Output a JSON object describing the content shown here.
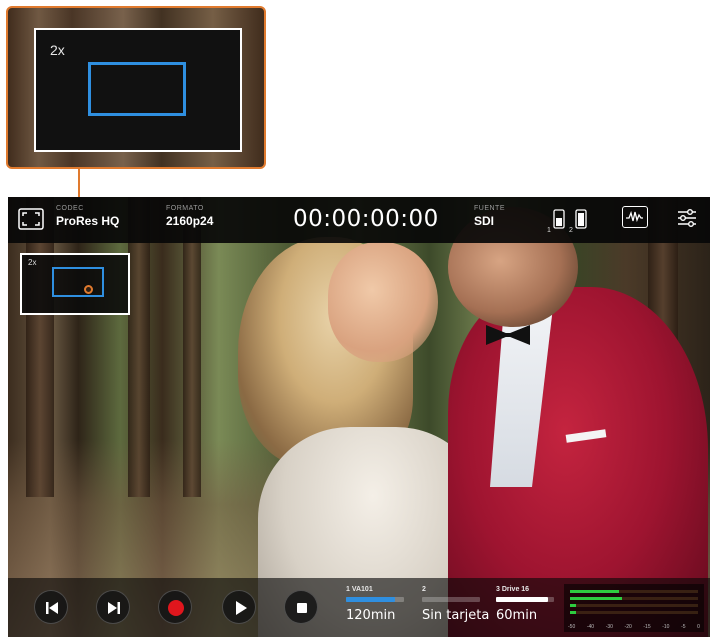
{
  "callout": {
    "zoom_label": "2x"
  },
  "topbar": {
    "codec": {
      "label": "CODEC",
      "value": "ProRes HQ"
    },
    "format": {
      "label": "FORMATO",
      "value": "2160p24"
    },
    "timecode": "00:00:00:00",
    "source": {
      "label": "FUENTE",
      "value": "SDI"
    },
    "slots": [
      {
        "number": "1"
      },
      {
        "number": "2"
      }
    ],
    "icons": {
      "fullscreen": "fullscreen-icon",
      "slots": "sd-card-icon",
      "scope": "waveform-icon",
      "settings": "sliders-icon"
    }
  },
  "inset": {
    "zoom_label": "2x"
  },
  "transport": {
    "buttons": [
      {
        "name": "skip-back-button",
        "icon": "skip-back-icon"
      },
      {
        "name": "skip-forward-button",
        "icon": "skip-forward-icon"
      },
      {
        "name": "record-button",
        "icon": "record-icon",
        "color": "#e0161d"
      },
      {
        "name": "play-button",
        "icon": "play-icon"
      },
      {
        "name": "stop-button",
        "icon": "stop-icon"
      }
    ]
  },
  "media": [
    {
      "slot_name": "1  VA101",
      "time": "120min",
      "fill_fraction": 0.85,
      "fill_color": "#2f8fe0"
    },
    {
      "slot_name": "2",
      "time": "Sin tarjeta",
      "fill_fraction": 0,
      "fill_color": "#ffffff"
    },
    {
      "slot_name": "3  Drive 16",
      "time": "60min",
      "fill_fraction": 0.9,
      "fill_color": "#ffffff"
    }
  ],
  "audio_meter": {
    "scale": [
      "-50",
      "-40",
      "-30",
      "-20",
      "-15",
      "-10",
      "-5",
      "0"
    ],
    "levels": [
      0.38,
      0.41,
      0.05,
      0.05
    ],
    "accent": "#2ecc40"
  }
}
